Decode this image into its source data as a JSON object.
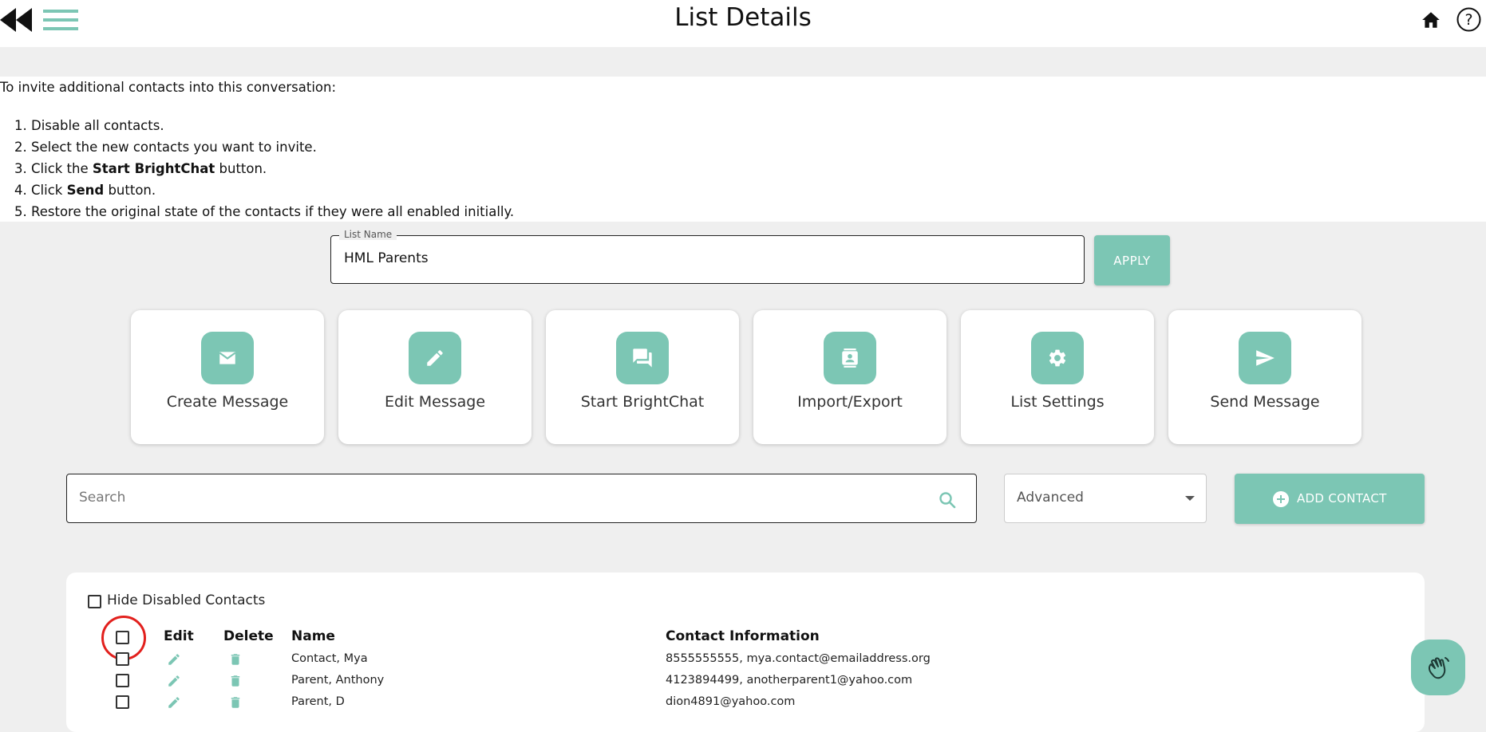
{
  "header": {
    "title": "List Details"
  },
  "instructions": {
    "intro": "To invite additional contacts into this conversation:",
    "steps": [
      {
        "num": "1.",
        "pre": "Disable all contacts.",
        "bold": "",
        "post": ""
      },
      {
        "num": "2.",
        "pre": "Select the new contacts you want to invite.",
        "bold": "",
        "post": ""
      },
      {
        "num": "3.",
        "pre": "Click the ",
        "bold": "Start BrightChat",
        "post": " button."
      },
      {
        "num": "4.",
        "pre": "Click ",
        "bold": "Send",
        "post": " button."
      },
      {
        "num": "5.",
        "pre": "Restore the original state of the contacts if they were all enabled initially.",
        "bold": "",
        "post": ""
      }
    ]
  },
  "list_name": {
    "label": "List Name",
    "value": "HML Parents",
    "apply_label": "APPLY"
  },
  "actions": [
    {
      "label": "Create Message",
      "icon": "envelope-icon"
    },
    {
      "label": "Edit Message",
      "icon": "pencil-icon"
    },
    {
      "label": "Start BrightChat",
      "icon": "chat-icon"
    },
    {
      "label": "Import/Export",
      "icon": "contact-card-icon"
    },
    {
      "label": "List Settings",
      "icon": "gear-icon"
    },
    {
      "label": "Send Message",
      "icon": "send-icon"
    }
  ],
  "search": {
    "placeholder": "Search"
  },
  "filter": {
    "selected": "Advanced"
  },
  "add_contact_label": "ADD CONTACT",
  "contacts": {
    "hide_disabled_label": "Hide Disabled Contacts",
    "columns": {
      "edit": "Edit",
      "delete": "Delete",
      "name": "Name",
      "contact_info": "Contact Information"
    },
    "rows": [
      {
        "name": "Contact, Mya",
        "info": "8555555555, mya.contact@emailaddress.org"
      },
      {
        "name": "Parent, Anthony",
        "info": "4123894499, anotherparent1@yahoo.com"
      },
      {
        "name": "Parent, D",
        "info": "dion4891@yahoo.com"
      }
    ]
  },
  "colors": {
    "accent": "#7cc6b4",
    "highlight": "#e2201d",
    "background": "#efefef"
  }
}
